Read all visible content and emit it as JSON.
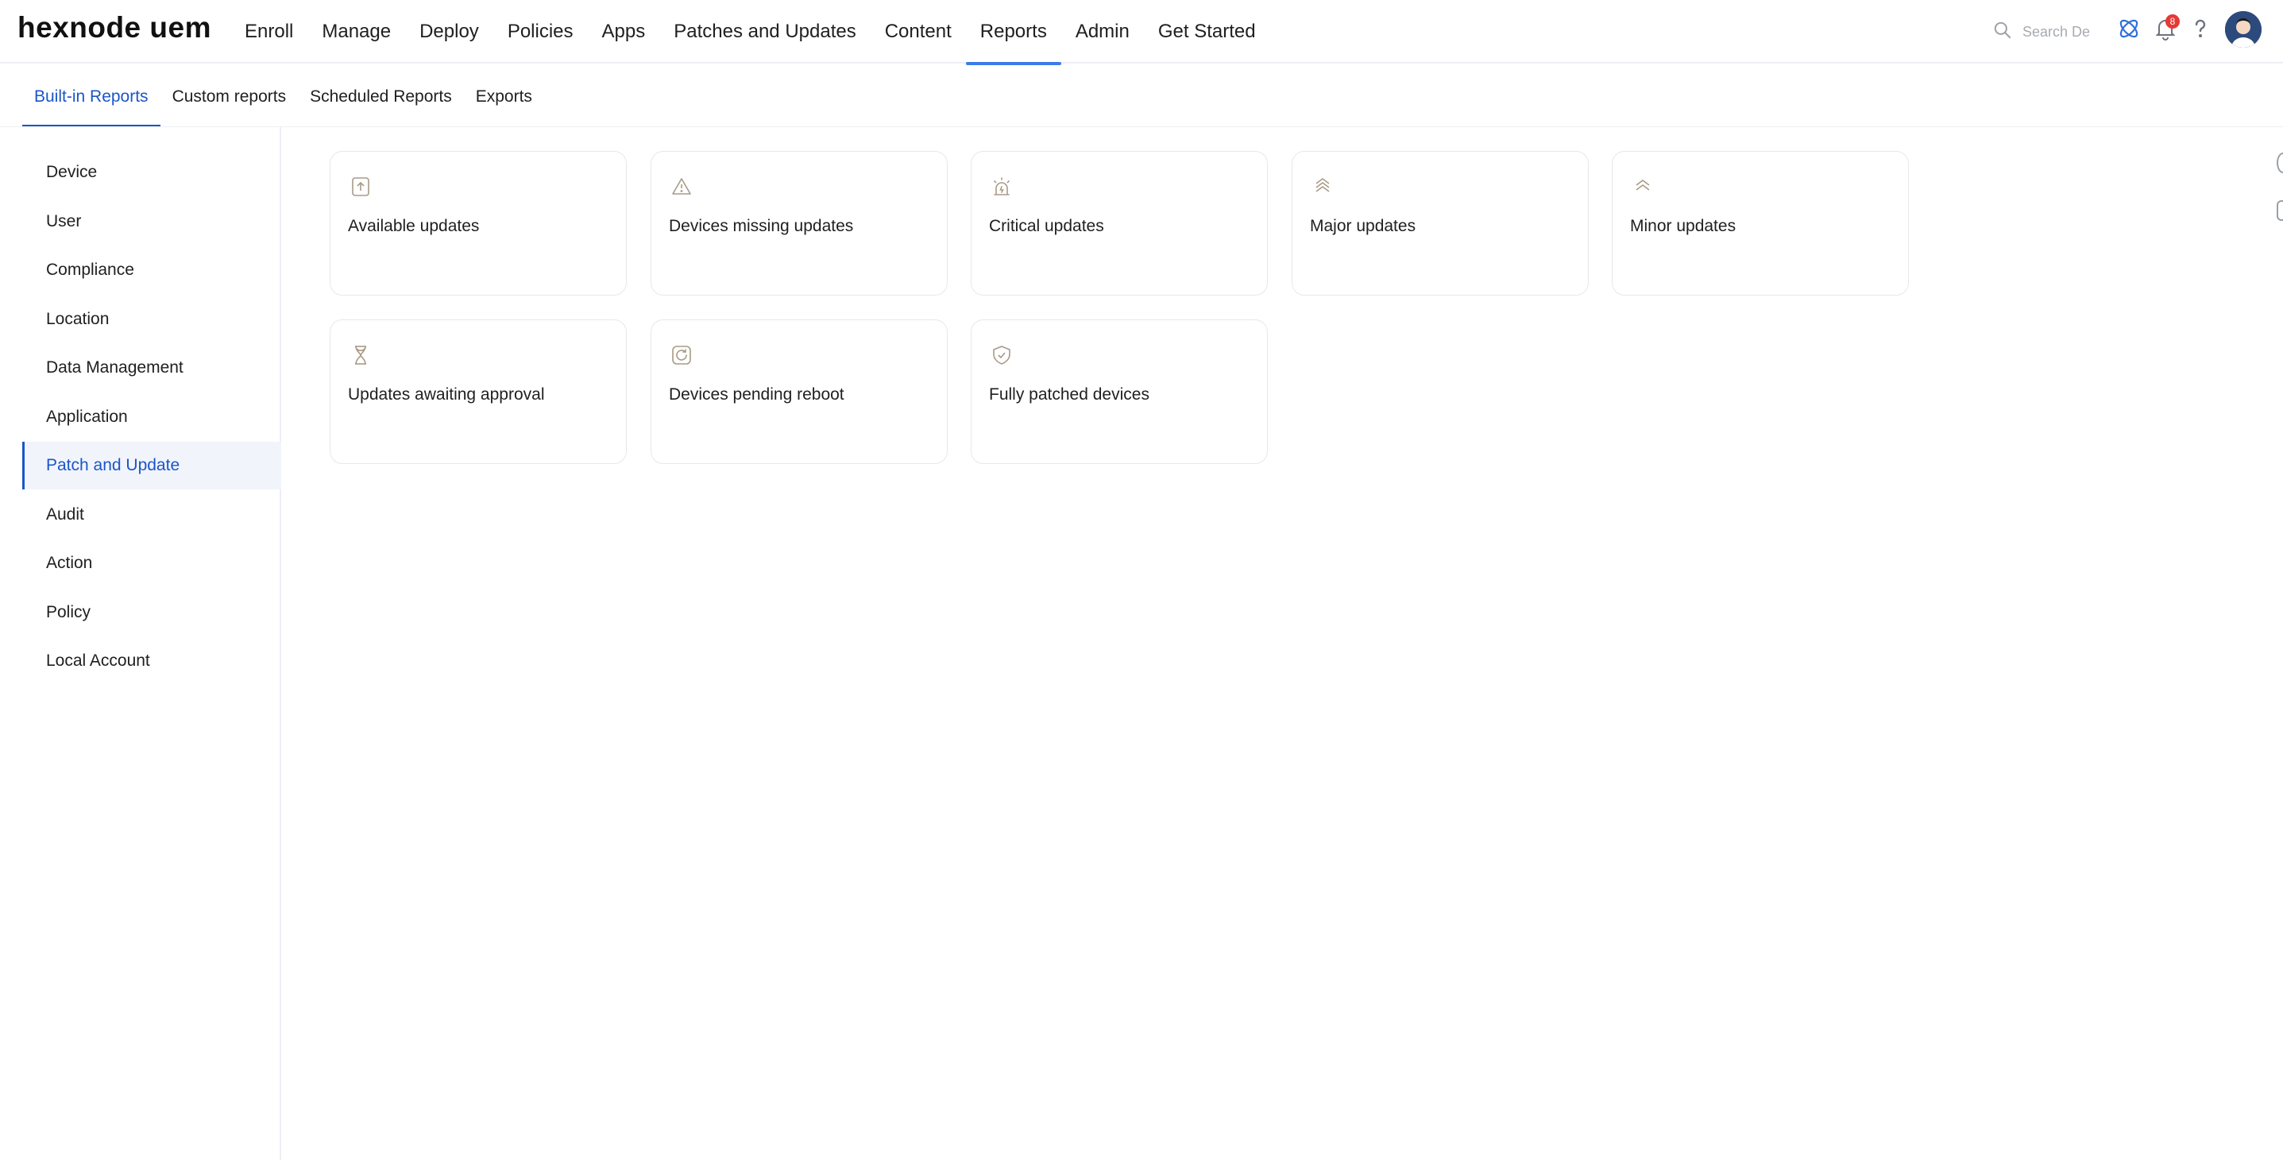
{
  "app": {
    "logo": "hexnode uem"
  },
  "main_nav": [
    {
      "label": "Enroll",
      "active": false
    },
    {
      "label": "Manage",
      "active": false
    },
    {
      "label": "Deploy",
      "active": false
    },
    {
      "label": "Policies",
      "active": false
    },
    {
      "label": "Apps",
      "active": false
    },
    {
      "label": "Patches and Updates",
      "active": false
    },
    {
      "label": "Content",
      "active": false
    },
    {
      "label": "Reports",
      "active": true
    },
    {
      "label": "Admin",
      "active": false
    },
    {
      "label": "Get Started",
      "active": false
    }
  ],
  "search": {
    "placeholder": "Search De"
  },
  "notifications": {
    "count": "8"
  },
  "sub_nav": [
    {
      "label": "Built-in Reports",
      "active": true
    },
    {
      "label": "Custom reports",
      "active": false
    },
    {
      "label": "Scheduled Reports",
      "active": false
    },
    {
      "label": "Exports",
      "active": false
    }
  ],
  "sidebar": [
    {
      "label": "Device"
    },
    {
      "label": "User"
    },
    {
      "label": "Compliance"
    },
    {
      "label": "Location"
    },
    {
      "label": "Data Management"
    },
    {
      "label": "Application"
    },
    {
      "label": "Patch and Update",
      "active": true
    },
    {
      "label": "Audit"
    },
    {
      "label": "Action"
    },
    {
      "label": "Policy"
    },
    {
      "label": "Local Account"
    }
  ],
  "report_cards": [
    {
      "title": "Available updates",
      "icon": "upload-icon"
    },
    {
      "title": "Devices missing updates",
      "icon": "warning-icon"
    },
    {
      "title": "Critical updates",
      "icon": "alarm-icon"
    },
    {
      "title": "Major updates",
      "icon": "triple-chevron-up-icon"
    },
    {
      "title": "Minor updates",
      "icon": "double-chevron-up-icon"
    },
    {
      "title": "Updates awaiting approval",
      "icon": "hourglass-icon"
    },
    {
      "title": "Devices pending reboot",
      "icon": "reboot-icon"
    },
    {
      "title": "Fully patched devices",
      "icon": "shield-check-icon"
    }
  ],
  "colors": {
    "accent": "#1a56c8",
    "nav_underline": "#3b7be8",
    "icon_stroke": "#a89a86",
    "badge": "#e53935"
  }
}
